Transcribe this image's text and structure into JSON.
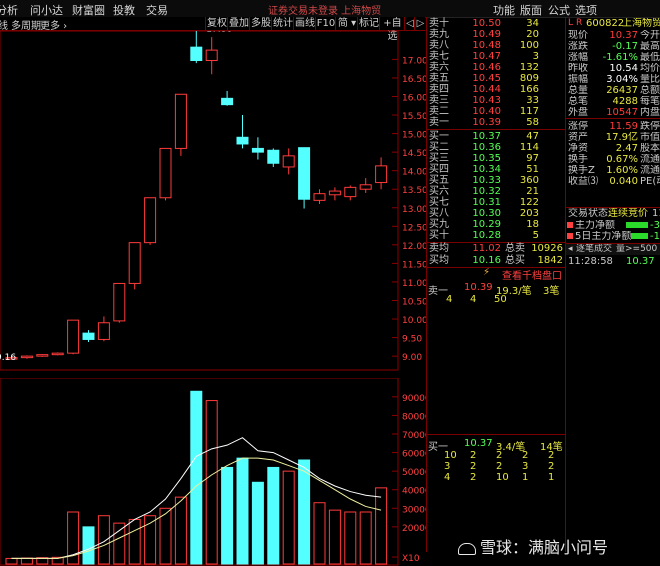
{
  "menu": {
    "items": [
      "分析",
      "问小达",
      "财富圈",
      "投教",
      "交易"
    ],
    "right_items": [
      "功能",
      "版面",
      "公式",
      "选项"
    ],
    "notice": "证券交易未登录  上海物贸"
  },
  "toolbar": {
    "left_labels": [
      "线",
      "多周期",
      "更多 ›"
    ],
    "buttons": [
      "复权",
      "叠加",
      "多股",
      "统计",
      "画线",
      "F10",
      "简 ▾",
      "标记",
      "+自选",
      "◁",
      "▷"
    ]
  },
  "chart": {
    "price_axis": [
      "17.00",
      "16.50",
      "16.00",
      "15.50",
      "15.00",
      "14.50",
      "14.00",
      "13.50",
      "13.00",
      "12.50",
      "12.00",
      "11.50",
      "11.00",
      "10.50",
      "10.00",
      "9.50",
      "9.00"
    ],
    "price_range": [
      8.68,
      17.55
    ],
    "high_marker": "17.86",
    "low_marker": "9.16",
    "volume_axis": [
      "90000",
      "80000",
      "70000",
      "60000",
      "50000",
      "40000",
      "30000",
      "20000",
      "X10"
    ],
    "volume_range": [
      0,
      98000
    ],
    "up_color": "#ff3b3b",
    "down_color": "#54ffff",
    "candles": [
      {
        "o": 8.93,
        "c": 8.96,
        "h": 8.98,
        "l": 8.9
      },
      {
        "o": 8.96,
        "c": 9.0,
        "h": 9.02,
        "l": 8.93
      },
      {
        "o": 9.0,
        "c": 9.04,
        "h": 9.05,
        "l": 8.98
      },
      {
        "o": 9.04,
        "c": 9.08,
        "h": 9.1,
        "l": 9.02
      },
      {
        "o": 9.08,
        "c": 9.97,
        "h": 9.97,
        "l": 9.05
      },
      {
        "o": 9.62,
        "c": 9.45,
        "h": 9.7,
        "l": 9.38
      },
      {
        "o": 9.45,
        "c": 9.9,
        "h": 10.07,
        "l": 9.4
      },
      {
        "o": 9.95,
        "c": 10.96,
        "h": 10.96,
        "l": 9.9
      },
      {
        "o": 10.96,
        "c": 12.06,
        "h": 12.06,
        "l": 10.8
      },
      {
        "o": 12.06,
        "c": 13.27,
        "h": 13.27,
        "l": 12.0
      },
      {
        "o": 13.27,
        "c": 14.6,
        "h": 14.6,
        "l": 13.2
      },
      {
        "o": 14.6,
        "c": 16.06,
        "h": 16.06,
        "l": 14.4
      },
      {
        "o": 17.33,
        "c": 16.97,
        "h": 17.86,
        "l": 16.9
      },
      {
        "o": 16.97,
        "c": 17.25,
        "h": 17.6,
        "l": 16.6
      },
      {
        "o": 15.95,
        "c": 15.78,
        "h": 16.15,
        "l": 15.75
      },
      {
        "o": 14.9,
        "c": 14.72,
        "h": 15.5,
        "l": 14.6
      },
      {
        "o": 14.6,
        "c": 14.5,
        "h": 14.9,
        "l": 14.3
      },
      {
        "o": 14.55,
        "c": 14.2,
        "h": 14.6,
        "l": 14.1
      },
      {
        "o": 14.1,
        "c": 14.4,
        "h": 14.6,
        "l": 13.9
      },
      {
        "o": 14.62,
        "c": 13.23,
        "h": 14.62,
        "l": 12.98
      },
      {
        "o": 13.2,
        "c": 13.38,
        "h": 13.5,
        "l": 13.1
      },
      {
        "o": 13.35,
        "c": 13.45,
        "h": 13.55,
        "l": 13.2
      },
      {
        "o": 13.3,
        "c": 13.55,
        "h": 13.6,
        "l": 13.2
      },
      {
        "o": 13.5,
        "c": 13.62,
        "h": 13.8,
        "l": 13.4
      },
      {
        "o": 13.68,
        "c": 14.13,
        "h": 14.36,
        "l": 13.5
      }
    ],
    "volumes": [
      3000,
      3200,
      3400,
      3600,
      28000,
      20000,
      26000,
      22000,
      24000,
      26000,
      30000,
      36000,
      93000,
      88000,
      52000,
      57000,
      44000,
      52000,
      50000,
      56000,
      33000,
      29000,
      28000,
      28000,
      41000
    ],
    "ma_lines": [
      [
        3000,
        3000,
        3000,
        3000,
        5000,
        8000,
        12000,
        18000,
        24000,
        28000,
        35000,
        46000,
        58000,
        62000,
        64000,
        68000,
        61000,
        60000,
        56000,
        52000,
        46000,
        42000,
        39000,
        37000,
        36000
      ],
      [
        3000,
        3000,
        3000,
        3000,
        4500,
        7000,
        10000,
        14000,
        18000,
        22000,
        27000,
        34000,
        42000,
        48000,
        53000,
        57000,
        57000,
        56000,
        53000,
        50000,
        45000,
        40000,
        35000,
        31000,
        29000
      ]
    ]
  },
  "order_book": {
    "asks": [
      {
        "label": "卖十",
        "price": "10.50",
        "vol": "34"
      },
      {
        "label": "卖九",
        "price": "10.49",
        "vol": "20"
      },
      {
        "label": "卖八",
        "price": "10.48",
        "vol": "100"
      },
      {
        "label": "卖七",
        "price": "10.47",
        "vol": "3"
      },
      {
        "label": "卖六",
        "price": "10.46",
        "vol": "132"
      },
      {
        "label": "卖五",
        "price": "10.45",
        "vol": "809"
      },
      {
        "label": "卖四",
        "price": "10.44",
        "vol": "166"
      },
      {
        "label": "卖三",
        "price": "10.43",
        "vol": "33"
      },
      {
        "label": "卖二",
        "price": "10.40",
        "vol": "117"
      },
      {
        "label": "卖一",
        "price": "10.39",
        "vol": "58"
      }
    ],
    "bids": [
      {
        "label": "买一",
        "price": "10.37",
        "vol": "47"
      },
      {
        "label": "买二",
        "price": "10.36",
        "vol": "114"
      },
      {
        "label": "买三",
        "price": "10.35",
        "vol": "97"
      },
      {
        "label": "买四",
        "price": "10.34",
        "vol": "51"
      },
      {
        "label": "买五",
        "price": "10.33",
        "vol": "360"
      },
      {
        "label": "买六",
        "price": "10.32",
        "vol": "21"
      },
      {
        "label": "买七",
        "price": "10.31",
        "vol": "122"
      },
      {
        "label": "买八",
        "price": "10.30",
        "vol": "203"
      },
      {
        "label": "买九",
        "price": "10.29",
        "vol": "18"
      },
      {
        "label": "买十",
        "price": "10.28",
        "vol": "5"
      }
    ],
    "ask_avg": {
      "label": "卖均",
      "price": "11.02",
      "tlabel": "总卖",
      "total": "10926"
    },
    "bid_avg": {
      "label": "买均",
      "price": "10.16",
      "tlabel": "总买",
      "total": "1842"
    },
    "queue_button": "查看千档盘口",
    "ask_queue": {
      "label": "卖一",
      "price": "10.39",
      "avg": "19.3/笔",
      "count": "3笔",
      "rows": [
        [
          "4",
          "4",
          "50"
        ]
      ]
    },
    "bid_queue": {
      "label": "买一",
      "price": "10.37",
      "avg": "3.4/笔",
      "count": "14笔",
      "rows": [
        [
          "10",
          "2",
          "2",
          "2",
          "2"
        ],
        [
          "3",
          "2",
          "2",
          "3",
          "2"
        ],
        [
          "4",
          "2",
          "10",
          "1",
          "1"
        ]
      ]
    }
  },
  "info": {
    "code": "600822",
    "name": "上海物贸",
    "rows": [
      {
        "label": "现价",
        "value": "10.37",
        "tail": "今开",
        "color": "#ff3b3b"
      },
      {
        "label": "涨跌",
        "value": "-0.17",
        "tail": "最高",
        "color": "#54ff54"
      },
      {
        "label": "涨幅",
        "value": "-1.61%",
        "tail": "最低",
        "color": "#54ff54"
      },
      {
        "label": "昨收",
        "value": "10.54",
        "tail": "均价",
        "color": "#ffffff"
      },
      {
        "label": "振幅",
        "value": "3.04%",
        "tail": "量比",
        "color": "#ffffff"
      },
      {
        "label": "总量",
        "value": "26437",
        "tail": "总额",
        "color": "#e8e840"
      },
      {
        "label": "总笔",
        "value": "4288",
        "tail": "每笔",
        "color": "#e8e840"
      },
      {
        "label": "外盘",
        "value": "10547",
        "tail": "内盘",
        "color": "#ff3b3b"
      },
      {
        "label": "涨停",
        "value": "11.59",
        "tail": "跌停",
        "color": "#ff3b3b"
      },
      {
        "label": "资产",
        "value": "17.9亿",
        "tail": "市值",
        "color": "#e8e840"
      },
      {
        "label": "净资",
        "value": "2.47",
        "tail": "股本",
        "color": "#e8e840"
      },
      {
        "label": "换手",
        "value": "0.67%",
        "tail": "流通",
        "color": "#e8e840"
      },
      {
        "label": "换手Z",
        "value": "1.60%",
        "tail": "流通",
        "color": "#e8e840"
      },
      {
        "label": "收益⑶",
        "value": "0.040",
        "tail": "PE(动",
        "color": "#e8e840"
      }
    ],
    "trade_status_label": "交易状态:",
    "trade_status_value": "连续竞价",
    "trade_status_tail": "11",
    "net1_label": "主力净额",
    "net1_value": "-3",
    "net5_label": "5日主力净额",
    "net5_value": "-1",
    "tab_label": "逐笔成交",
    "tab_right": "量>=500 额>",
    "last_time": "11:28:58",
    "last_price": "10.37"
  },
  "watermark": "雪球：满脑小问号"
}
